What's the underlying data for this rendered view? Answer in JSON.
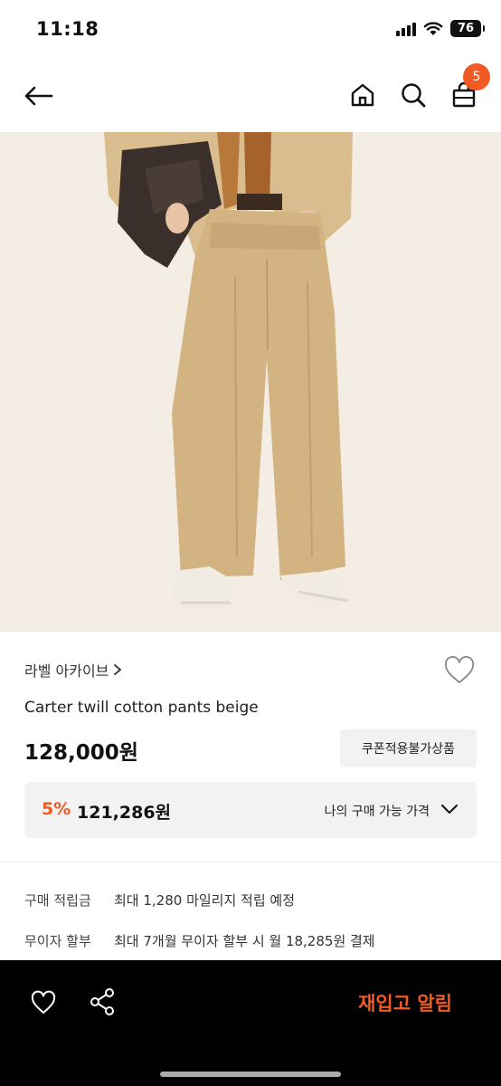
{
  "status_bar": {
    "time": "11:18",
    "battery": "76"
  },
  "nav": {
    "cart_count": "5"
  },
  "product": {
    "brand": "라벨 아카이브",
    "name": "Carter twill cotton pants beige",
    "price": "128,000원",
    "coupon_label": "쿠폰적용불가상품",
    "discount_rate": "5%",
    "discount_price": "121,286원",
    "my_price_label": "나의 구매 가능 가격"
  },
  "details": [
    {
      "label": "구매 적립금",
      "value": "최대 1,280 마일리지 적립 예정"
    },
    {
      "label": "무이자 할부",
      "value": "최대 7개월 무이자 할부 시 월 18,285원 결제"
    }
  ],
  "bottom_bar": {
    "restock_label": "재입고 알림"
  },
  "colors": {
    "accent": "#f05a23",
    "chip_bg": "#f2f2f3",
    "bottom_bg": "#000000"
  }
}
